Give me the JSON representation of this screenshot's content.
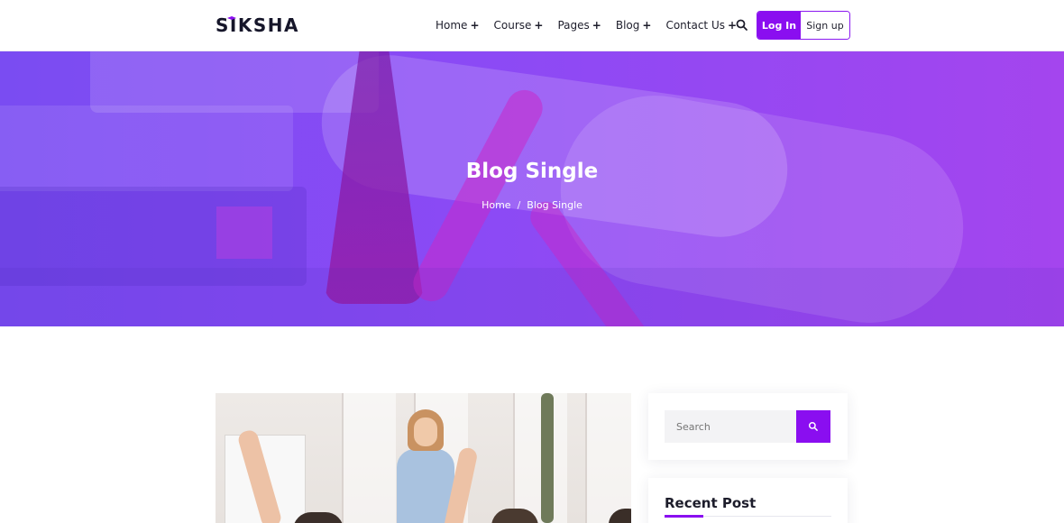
{
  "brand": {
    "logo_text": "SIKSHA",
    "accent_color": "#8a0ef0"
  },
  "nav": {
    "items": [
      {
        "label": "Home",
        "suffix": "+"
      },
      {
        "label": "Course",
        "suffix": "+"
      },
      {
        "label": "Pages",
        "suffix": "+"
      },
      {
        "label": "Blog",
        "suffix": "+"
      },
      {
        "label": "Contact Us",
        "suffix": "+"
      }
    ],
    "search_icon": "search-icon",
    "login_label": "Log In",
    "signup_label": "Sign up"
  },
  "hero": {
    "title": "Blog Single",
    "breadcrumb": {
      "home": "Home",
      "separator": "/",
      "current": "Blog Single"
    }
  },
  "sidebar": {
    "search": {
      "placeholder": "Search",
      "button_icon": "search-icon"
    },
    "recent": {
      "title": "Recent Post"
    }
  }
}
